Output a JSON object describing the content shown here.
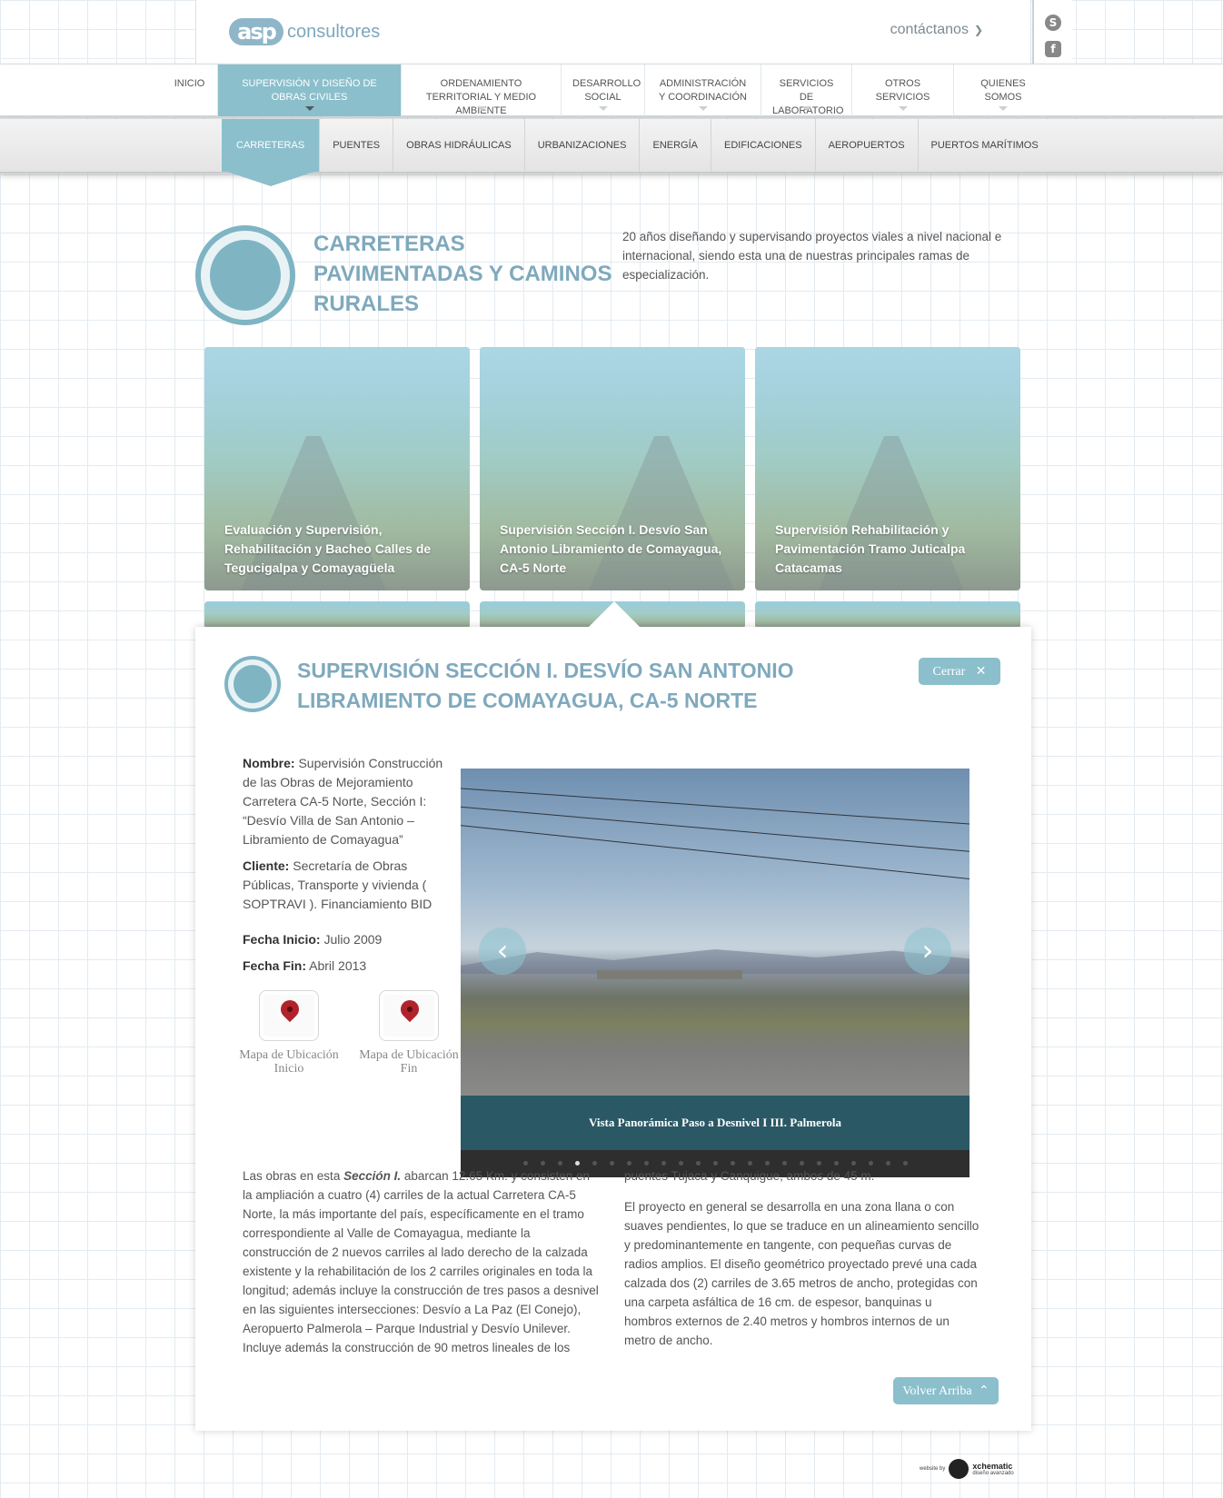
{
  "brand": {
    "mark": "asp",
    "name": "consultores"
  },
  "header": {
    "contact_label": "contáctanos",
    "skype_icon": "skype-icon",
    "facebook_icon": "facebook-icon"
  },
  "main_nav": [
    {
      "label": "INICIO"
    },
    {
      "label": "SUPERVISIÓN Y DISEÑO DE OBRAS CIVILES",
      "active": true
    },
    {
      "label": "ORDENAMIENTO TERRITORIAL Y MEDIO AMBIENTE"
    },
    {
      "label": "DESARROLLO SOCIAL"
    },
    {
      "label": "ADMINISTRACIÓN Y COORDINACIÓN"
    },
    {
      "label": "SERVICIOS DE LABORATORIO"
    },
    {
      "label": "OTROS SERVICIOS"
    },
    {
      "label": "QUIENES SOMOS"
    }
  ],
  "sub_nav": [
    {
      "label": "CARRETERAS",
      "active": true
    },
    {
      "label": "PUENTES"
    },
    {
      "label": "OBRAS HIDRÁULICAS"
    },
    {
      "label": "URBANIZACIONES"
    },
    {
      "label": "ENERGÍA"
    },
    {
      "label": "EDIFICACIONES"
    },
    {
      "label": "AEROPUERTOS"
    },
    {
      "label": "PUERTOS MARÍTIMOS"
    }
  ],
  "section": {
    "title": "CARRETERAS PAVIMENTADAS Y CAMINOS RURALES",
    "description": "20 años diseñando y supervisando proyectos viales a nivel nacional e internacional, siendo esta una de nuestras principales ramas de especialización."
  },
  "projects": [
    {
      "caption": "Evaluación y Supervisión, Rehabilitación y Bacheo Calles de Tegucigalpa y Comayagüela"
    },
    {
      "caption": "Supervisión Sección I. Desvío San Antonio Libramiento de Comayagua, CA-5 Norte"
    },
    {
      "caption": "Supervisión Rehabilitación y Pavimentación Tramo Juticalpa Catacamas"
    }
  ],
  "detail": {
    "title": "SUPERVISIÓN SECCIÓN I. DESVÍO SAN ANTONIO LIBRAMIENTO DE COMAYAGUA, CA-5 NORTE",
    "close_label": "Cerrar",
    "nombre_label": "Nombre:",
    "nombre": "Supervisión Construcción de las Obras de Mejoramiento Carretera CA-5 Norte, Sección I: “Desvío Villa de San Antonio – Libramiento de Comayagua”",
    "cliente_label": "Cliente:",
    "cliente": "Secretaría de Obras Públicas, Transporte y vivienda ( SOPTRAVI ). Financiamiento BID",
    "fecha_inicio_label": "Fecha Inicio:",
    "fecha_inicio": "Julio 2009",
    "fecha_fin_label": "Fecha Fin:",
    "fecha_fin": "Abril 2013",
    "map_start_label": "Mapa de Ubicación Inicio",
    "map_end_label": "Mapa de Ubicación Fin",
    "slide_caption": "Vista Panorámica Paso a Desnivel I III. Palmerola",
    "slide_total": 23,
    "slide_active": 3,
    "body_left_prefix": "Las obras en esta ",
    "body_left_em": "Sección I.",
    "body_left": " abarcan 12.65 Km.  y consisten en la ampliación a cuatro (4) carriles de la actual  Carretera CA-5 Norte, la más importante del país, específicamente en el tramo correspondiente al Valle de Comayagua, mediante la construcción de 2 nuevos carriles al lado derecho de la calzada existente y la rehabilitación de los 2 carriles originales en toda la longitud;   además incluye la construcción de tres pasos a desnivel en las siguientes intersecciones:  Desvío a La Paz (El Conejo),  Aeropuerto Palmerola – Parque Industrial y Desvío Unilever.   Incluye además la construcción de 90 metros lineales de los",
    "body_right_1": "puentes Tujaca y Canquigue, ambos de 45 m.",
    "body_right_2": "El proyecto en general se desarrolla en una zona llana o con suaves pendientes, lo que se traduce en un alineamiento sencillo y predominantemente en tangente, con pequeñas curvas de radios amplios. El diseño geométrico proyectado prevé una cada calzada dos (2) carriles de 3.65 metros de ancho, protegidas con una carpeta asfáltica de 16 cm. de espesor, banquinas u hombros externos de 2.40 metros y hombros internos de un metro de ancho.",
    "back_top_label": "Volver Arriba"
  },
  "footer": {
    "credit_small": "website by",
    "credit_name": "xchematic",
    "credit_tag": "diseño avanzado"
  },
  "colors": {
    "accent": "#8bbfcc",
    "title": "#7fa9bd",
    "caption_bar": "#2b5865"
  }
}
